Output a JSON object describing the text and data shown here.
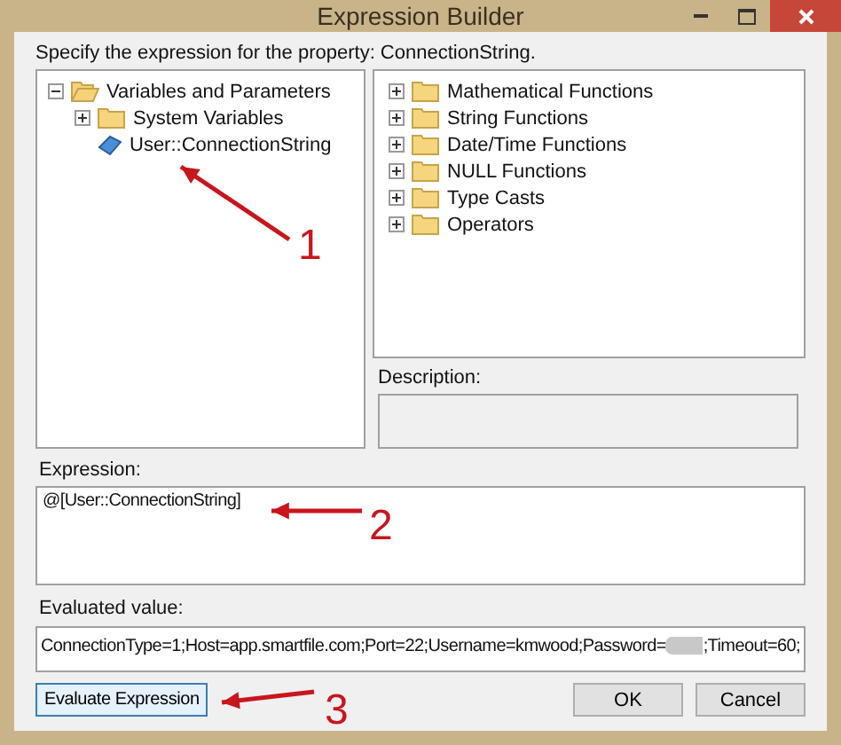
{
  "window": {
    "title": "Expression Builder"
  },
  "prompt": "Specify the expression for the property: ConnectionString.",
  "left_tree": [
    {
      "kind": "folder",
      "label": "Variables and Parameters",
      "expanded": true,
      "children": [
        {
          "kind": "folder",
          "label": "System Variables",
          "expanded": false
        },
        {
          "kind": "variable",
          "label": "User::ConnectionString"
        }
      ]
    }
  ],
  "right_tree": [
    {
      "kind": "folder",
      "label": "Mathematical Functions",
      "expanded": false
    },
    {
      "kind": "folder",
      "label": "String Functions",
      "expanded": false
    },
    {
      "kind": "folder",
      "label": "Date/Time Functions",
      "expanded": false
    },
    {
      "kind": "folder",
      "label": "NULL Functions",
      "expanded": false
    },
    {
      "kind": "folder",
      "label": "Type Casts",
      "expanded": false
    },
    {
      "kind": "folder",
      "label": "Operators",
      "expanded": false
    }
  ],
  "description": {
    "label": "Description:"
  },
  "expression": {
    "label": "Expression:",
    "value": "@[User::ConnectionString]"
  },
  "evaluated": {
    "label": "Evaluated value:",
    "value_before": "ConnectionType=1;Host=app.smartfile.com;Port=22;Username=kmwood;Password=",
    "value_after": ";Timeout=60;"
  },
  "buttons": [
    {
      "label": "Evaluate Expression",
      "kind": "left"
    },
    {
      "label": "OK",
      "kind": "right"
    },
    {
      "label": "Cancel",
      "kind": "right"
    }
  ],
  "annotations": [
    {
      "number": "1"
    },
    {
      "number": "2"
    },
    {
      "number": "3"
    }
  ]
}
